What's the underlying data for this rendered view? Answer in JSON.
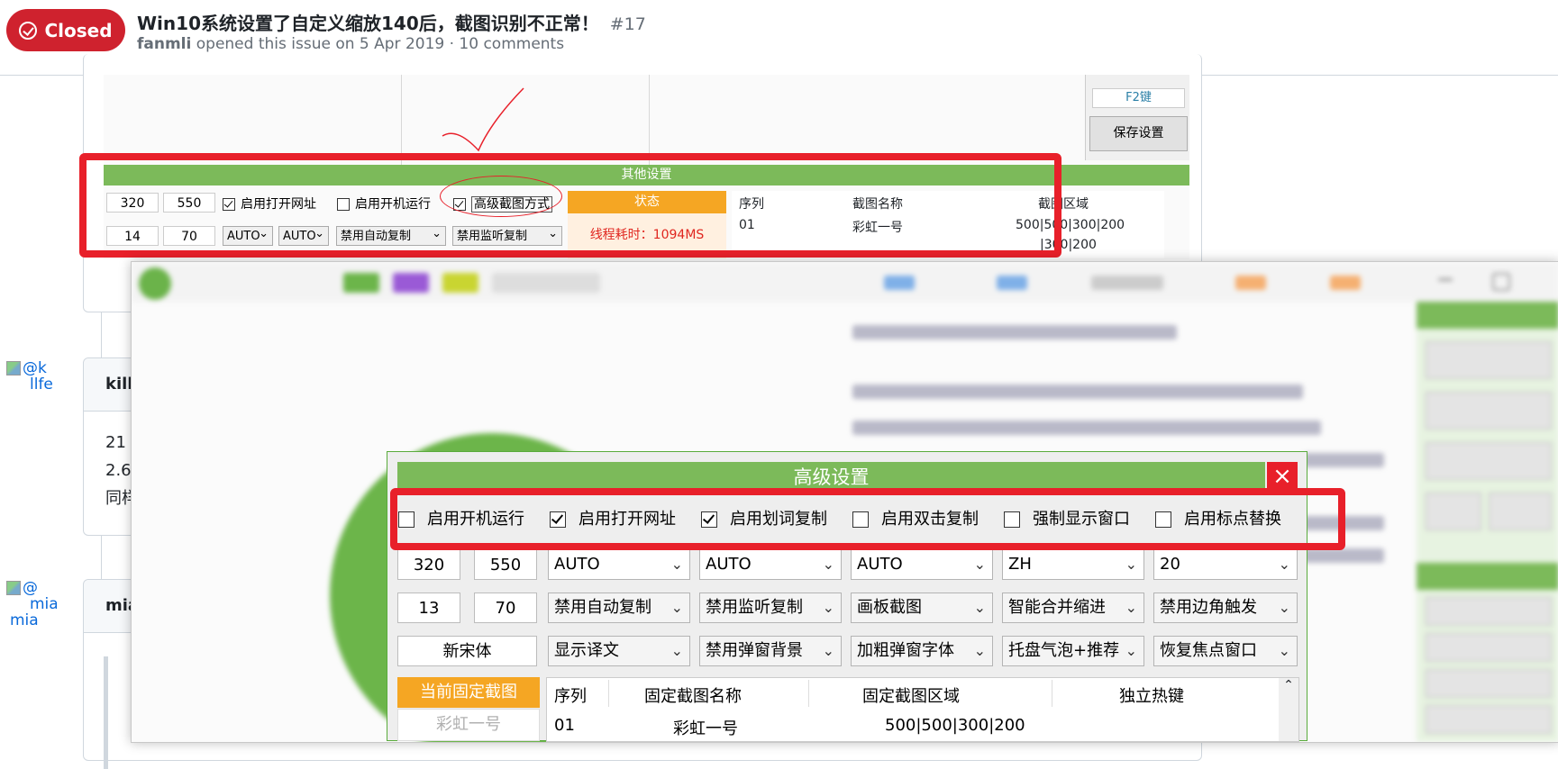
{
  "issue": {
    "status": "Closed",
    "title": "Win10系统设置了自定义缩放140后，截图识别不正常！",
    "number": "#17",
    "author": "fanmli",
    "meta_rest": "opened this issue on 5 Apr 2019 · 10 comments"
  },
  "comments": [
    {
      "avatar_alt_1": "@k",
      "avatar_alt_2": "llfe",
      "author": "kill",
      "body_lines": [
        "21",
        "2.6",
        "同样"
      ]
    },
    {
      "avatar_alt_1": "@",
      "avatar_alt_2": "mia",
      "avatar_alt_3": "mia",
      "author": "mia"
    }
  ],
  "top_shot": {
    "hotkey": "F2键",
    "save_label": "保存设置",
    "section_title": "其他设置",
    "row1": {
      "w": "320",
      "h": "550",
      "open_url": "启用打开网址",
      "autostart": "启用开机运行",
      "advanced": "高级截图方式"
    },
    "row2": {
      "a": "14",
      "b": "70",
      "d1": "AUTO",
      "d2": "AUTO",
      "d3": "禁用自动复制",
      "d4": "禁用监听复制"
    },
    "state_label": "状态",
    "state_value": "线程耗时：1094MS",
    "table": {
      "h1": "序列",
      "h2": "截图名称",
      "h3": "截图区域",
      "r_seq": "01",
      "r_name": "彩虹一号",
      "r_area": "500|500|300|200",
      "r2_area": "|300|200"
    }
  },
  "advanced": {
    "title": "高级设置",
    "close": "×",
    "checkboxes": [
      {
        "label": "启用开机运行",
        "checked": false
      },
      {
        "label": "启用打开网址",
        "checked": true
      },
      {
        "label": "启用划词复制",
        "checked": true
      },
      {
        "label": "启用双击复制",
        "checked": false
      },
      {
        "label": "强制显示窗口",
        "checked": false
      },
      {
        "label": "启用标点替换",
        "checked": false
      }
    ],
    "row1": {
      "a": "320",
      "b": "550",
      "d1": "AUTO",
      "d2": "AUTO",
      "d3": "AUTO",
      "d4": "ZH",
      "d5": "20"
    },
    "row2": {
      "a": "13",
      "b": "70",
      "d1": "禁用自动复制",
      "d2": "禁用监听复制",
      "d3": "画板截图",
      "d4": "智能合并缩进",
      "d5": "禁用边角触发"
    },
    "row3": {
      "font": "新宋体",
      "d1": "显示译文",
      "d2": "禁用弹窗背景",
      "d3": "加粗弹窗字体",
      "d4": "托盘气泡+推荐",
      "d5": "恢复焦点窗口"
    },
    "current_fixed": "当前固定截图",
    "current_item": "彩虹一号",
    "table": {
      "h1": "序列",
      "h2": "固定截图名称",
      "h3": "固定截图区域",
      "h4": "独立热键",
      "r_seq": "01",
      "r_name": "彩虹一号",
      "r_area": "500|500|300|200"
    }
  },
  "colors": {
    "closed": "#cf222e",
    "green": "#7cba5a",
    "orange": "#f5a623",
    "red_highlight": "#e8202a"
  }
}
